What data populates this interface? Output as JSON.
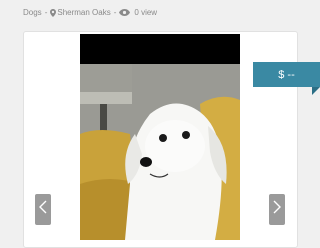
{
  "listing_meta": {
    "category": "Dogs",
    "location": "Sherman Oaks",
    "views": "0 view",
    "separator": "-",
    "location_icon": "map-pin-icon",
    "views_icon": "eye-icon"
  },
  "gallery": {
    "photo_alt": "White fluffy dog sitting on a yellow couch",
    "prev_icon": "chevron-left-icon",
    "next_icon": "chevron-right-icon"
  },
  "price": {
    "label": "$ --",
    "color": "#3a89a3"
  }
}
